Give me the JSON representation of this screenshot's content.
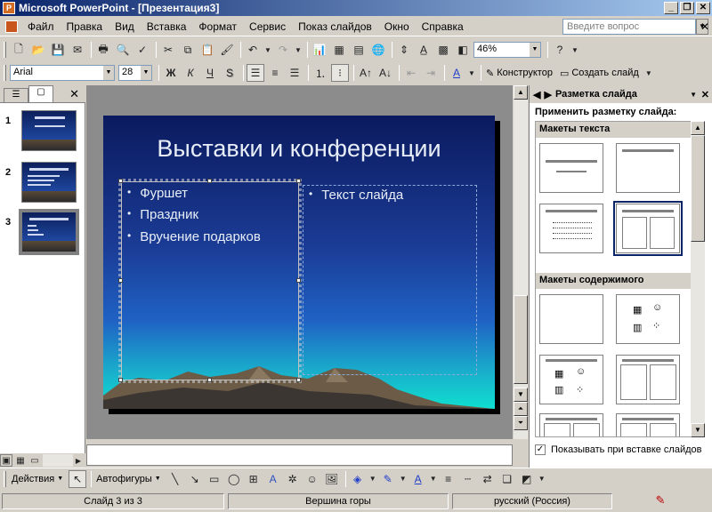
{
  "window": {
    "title": "Microsoft PowerPoint - [Презентация3]",
    "min": "_",
    "max": "❐",
    "close": "✕"
  },
  "menu": {
    "items": [
      "Файл",
      "Правка",
      "Вид",
      "Вставка",
      "Формат",
      "Сервис",
      "Показ слайдов",
      "Окно",
      "Справка"
    ],
    "help_placeholder": "Введите вопрос",
    "close_doc": "✕"
  },
  "standard_toolbar": {
    "zoom": "46%"
  },
  "format_toolbar": {
    "font": "Arial",
    "size": "28",
    "bold": "Ж",
    "italic": "К",
    "underline": "Ч",
    "shadow": "S",
    "designer_label": "Конструктор",
    "new_slide_label": "Создать слайд"
  },
  "outline_pane": {
    "tab_outline": "☰",
    "tab_slides": "▢",
    "close": "✕",
    "slides": [
      {
        "num": "1"
      },
      {
        "num": "2"
      },
      {
        "num": "3"
      }
    ]
  },
  "slide": {
    "title": "Выставки и конференции",
    "left_bullets": [
      "Фуршет",
      "Праздник",
      "Вручение подарков"
    ],
    "right_bullets": [
      "Текст слайда"
    ]
  },
  "taskpane": {
    "title": "Разметка слайда",
    "apply_label": "Применить разметку слайда:",
    "section_text": "Макеты текста",
    "section_content": "Макеты содержимого",
    "show_on_insert": "Показывать при вставке слайдов",
    "show_on_insert_checked": true
  },
  "drawing_toolbar": {
    "actions_label": "Действия",
    "autoshapes_label": "Автофигуры"
  },
  "statusbar": {
    "slide_info": "Слайд 3 из 3",
    "design": "Вершина горы",
    "language": "русский (Россия)"
  },
  "colors": {
    "title_bar_start": "#0a246a",
    "slide_top": "#0b1a5e",
    "slide_bottom": "#0fe0d0",
    "selected_layout": "#0a246a"
  }
}
